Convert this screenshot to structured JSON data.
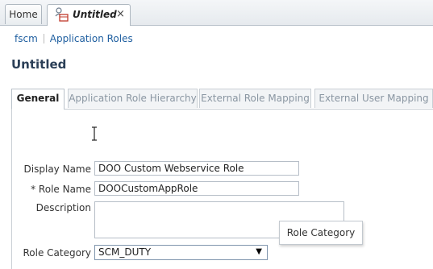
{
  "top_tabs": {
    "home_label": "Home",
    "active_label": "Untitled",
    "close_glyph": "×",
    "active_icon": "role-icon"
  },
  "breadcrumb": {
    "items": [
      "fscm",
      "Application Roles"
    ]
  },
  "page_title": "Untitled",
  "sub_tabs": [
    "General",
    "Application Role Hierarchy",
    "External Role Mapping",
    "External User Mapping"
  ],
  "form": {
    "display_name_label": "Display Name",
    "display_name_value": "DOO Custom Webservice Role",
    "role_name_label": "* Role Name",
    "role_name_value": "DOOCustomAppRole",
    "description_label": "Description",
    "description_value": "",
    "role_category_label": "Role Category",
    "role_category_value": "SCM_DUTY",
    "dropdown_arrow": "▼"
  },
  "tooltip": "Role Category"
}
